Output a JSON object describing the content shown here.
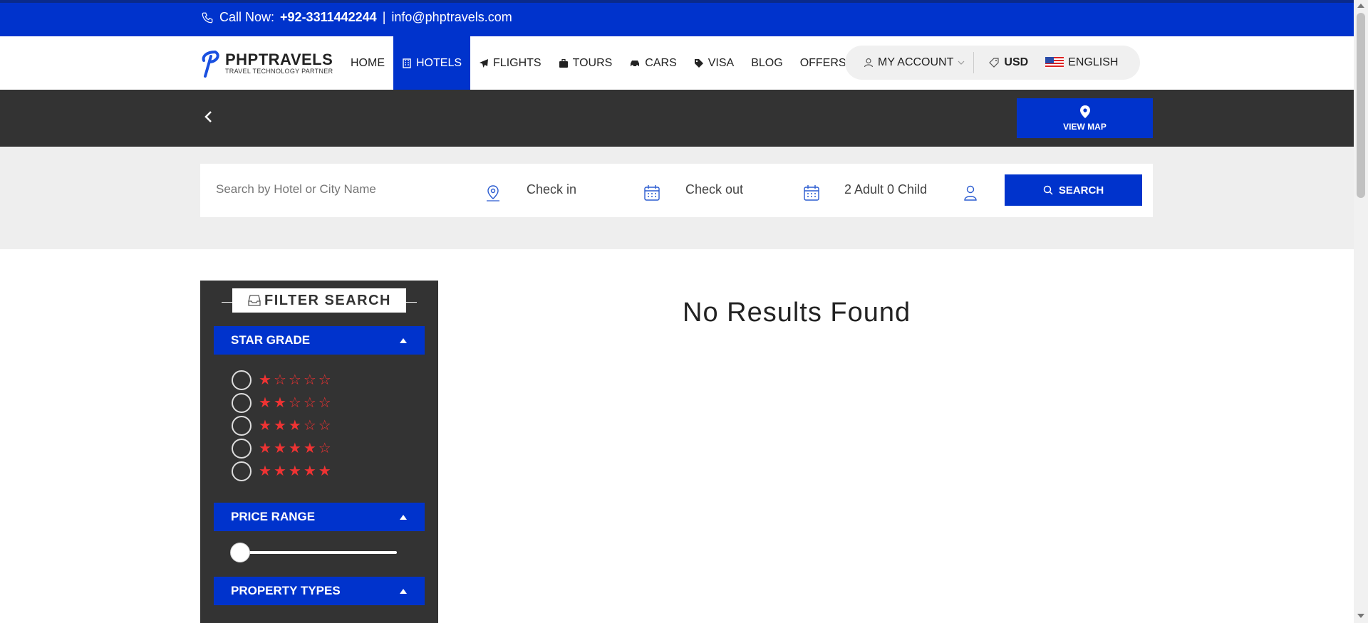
{
  "topbar": {
    "call_label": "Call Now:",
    "phone": "+92-3311442244",
    "separator": "|",
    "email": "info@phptravels.com"
  },
  "logo": {
    "title": "PHPTRAVELS",
    "subtitle": "TRAVEL TECHNOLOGY PARTNER"
  },
  "nav": {
    "items": [
      {
        "label": "HOME",
        "icon": ""
      },
      {
        "label": "HOTELS",
        "icon": "building-icon"
      },
      {
        "label": "FLIGHTS",
        "icon": "plane-icon"
      },
      {
        "label": "TOURS",
        "icon": "suitcase-icon"
      },
      {
        "label": "CARS",
        "icon": "car-icon"
      },
      {
        "label": "VISA",
        "icon": "tag-icon"
      },
      {
        "label": "BLOG",
        "icon": ""
      },
      {
        "label": "OFFERS",
        "icon": ""
      }
    ],
    "account": "MY ACCOUNT",
    "currency": "USD",
    "language": "ENGLISH"
  },
  "darkbar": {
    "view_map": "VIEW MAP"
  },
  "search": {
    "placeholder": "Search by Hotel or City Name",
    "checkin": "Check in",
    "checkout": "Check out",
    "guests": "2 Adult 0 Child",
    "button": "SEARCH"
  },
  "filters": {
    "title": "FILTER SEARCH",
    "star_grade": "STAR GRADE",
    "price_range": "PRICE RANGE",
    "property_types": "PROPERTY TYPES",
    "star_rows": [
      1,
      2,
      3,
      4,
      5
    ],
    "price_slider_value": 0
  },
  "results": {
    "message": "No Results Found"
  },
  "colors": {
    "brand": "#0033cc",
    "dark": "#333333",
    "star": "#e33333"
  }
}
